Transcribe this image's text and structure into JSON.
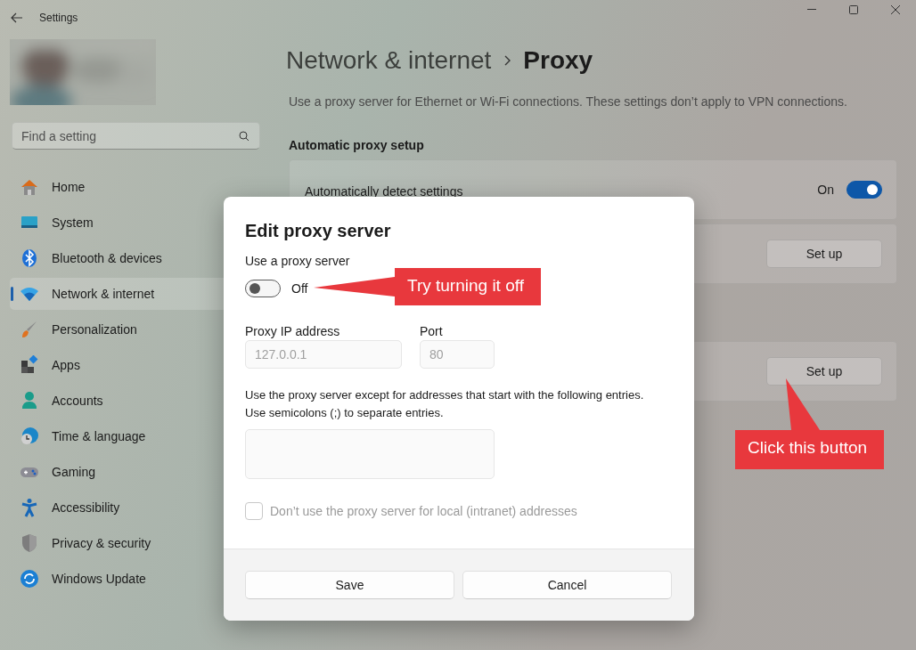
{
  "window": {
    "title": "Settings"
  },
  "sidebar": {
    "search": {
      "placeholder": "Find a setting"
    },
    "items": [
      {
        "label": "Home",
        "selected": false
      },
      {
        "label": "System",
        "selected": false
      },
      {
        "label": "Bluetooth & devices",
        "selected": false
      },
      {
        "label": "Network & internet",
        "selected": true
      },
      {
        "label": "Personalization",
        "selected": false
      },
      {
        "label": "Apps",
        "selected": false
      },
      {
        "label": "Accounts",
        "selected": false
      },
      {
        "label": "Time & language",
        "selected": false
      },
      {
        "label": "Gaming",
        "selected": false
      },
      {
        "label": "Accessibility",
        "selected": false
      },
      {
        "label": "Privacy & security",
        "selected": false
      },
      {
        "label": "Windows Update",
        "selected": false
      }
    ]
  },
  "breadcrumb": {
    "parent": "Network & internet",
    "current": "Proxy"
  },
  "description": "Use a proxy server for Ethernet or Wi-Fi connections. These settings don’t apply to VPN connections.",
  "automatic_section": {
    "title": "Automatic proxy setup",
    "detect": {
      "label": "Automatically detect settings",
      "state_label": "On",
      "on": true
    },
    "script_button": "Set up"
  },
  "manual_button": "Set up",
  "dialog": {
    "title": "Edit proxy server",
    "toggle_label": "Use a proxy server",
    "toggle": {
      "on": false,
      "state_label": "Off"
    },
    "ip": {
      "label": "Proxy IP address",
      "value": "127.0.0.1",
      "disabled": true
    },
    "port": {
      "label": "Port",
      "value": "80",
      "disabled": true
    },
    "exceptions_label": "Use the proxy server except for addresses that start with the following entries.\nUse semicolons (;) to separate entries.",
    "local": {
      "label": "Don’t use the proxy server for local (intranet) addresses",
      "checked": false,
      "disabled": true
    },
    "buttons": [
      "Save",
      "Cancel"
    ]
  },
  "callouts": [
    {
      "text": "Try turning it off"
    },
    {
      "text": "Click this button"
    }
  ]
}
